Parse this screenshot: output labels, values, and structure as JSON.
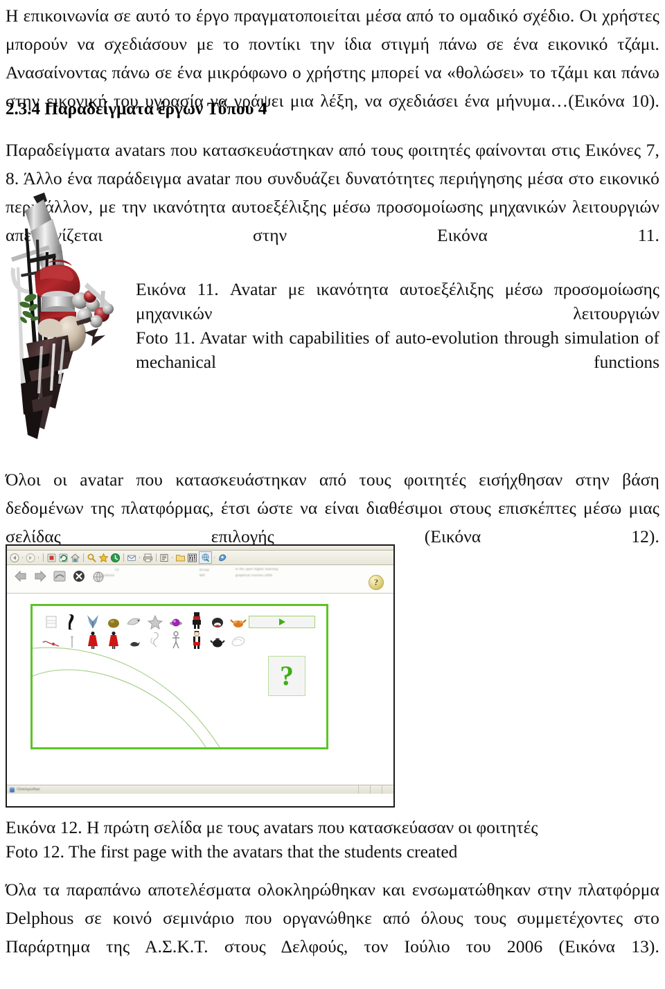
{
  "document": {
    "paragraph_1": "Η επικοινωνία σε αυτό το έργο πραγματοποιείται μέσα από το ομαδικό σχέδιο. Οι χρήστες μπορούν να σχεδιάσουν με το ποντίκι την ίδια στιγμή πάνω σε ένα εικονικό τζάμι. Ανασαίνοντας πάνω σε ένα μικρόφωνο ο χρήστης μπορεί να «θολώσει» το τζάμι και πάνω στην εικονική του υγρασία να γράψει μια λέξη, να σχεδιάσει ένα μήνυμα…(Εικόνα 10).",
    "heading_234": "2.3.4 Παραδείγματα έργων Τύπου 4",
    "paragraph_2": "Παραδείγματα avatars που κατασκευάστηκαν από τους φοιτητές φαίνονται στις Εικόνες 7, 8. Άλλο ένα παράδειγμα avatar που συνδυάζει δυνατότητες περιήγησης μέσα στο εικονικό περιβάλλον, με την ικανότητα αυτοεξέλιξης μέσω προσομοίωσης μηχανικών λειτουργιών απεικονίζεται στην Εικόνα 11.",
    "caption_11_gr": "Εικόνα 11. Avatar με ικανότητα αυτοεξέλιξης μέσω προσομοίωσης μηχανικών λειτουργιών",
    "caption_11_en": "Foto 11. Avatar with capabilities of auto-evolution through simulation of mechanical functions",
    "paragraph_3": "Όλοι οι avatar που κατασκευάστηκαν από τους φοιτητές εισήχθησαν στην βάση δεδομένων της πλατφόρμας, έτσι ώστε να είναι διαθέσιμοι στους επισκέπτες μέσω μιας σελίδας επιλογής (Εικόνα 12).",
    "caption_12_gr": "Εικόνα 12. Η πρώτη σελίδα με τους avatars που κατασκεύασαν  οι φοιτητές",
    "caption_12_en": "Foto 12. The first page with the avatars that the students created",
    "paragraph_4": "Όλα τα παραπάνω αποτελέσματα ολοκληρώθηκαν και ενσωματώθηκαν στην πλατφόρμα Delphous σε κοινό σεμινάριο που οργανώθηκε από όλους τους συμμετέχοντες στο Παράρτημα της Α.Σ.Κ.Τ. στους Δελφούς, τον Ιούλιο του 2006 (Εικόνα 13)."
  },
  "figure_11": {
    "alt": "3D rendered avatar composed of metallic cylinders, red fabric, spheres and dark blades",
    "palette": {
      "metal": "#c9c9c9",
      "metal_dark": "#8a8a8a",
      "red": "#9e1f22",
      "red_light": "#c4373a",
      "blade": "#4a3535",
      "green": "#3f6b2d",
      "skin": "#d9cdbd"
    }
  },
  "figure_12": {
    "browser": {
      "toolbar_icons": [
        "back-icon",
        "forward-icon",
        "stop-icon",
        "refresh-icon",
        "home-icon",
        "search-icon",
        "favorites-icon",
        "history-icon",
        "mail-icon",
        "print-icon",
        "edit-icon",
        "folder-icon",
        "messenger-icon",
        "translate-icon",
        "realplayer-icon"
      ],
      "statusbar_text": "Ολοκληρώθηκε"
    },
    "page": {
      "nav_icons": [
        "previous-arrow-icon",
        "next-arrow-icon",
        "shuffle-icon",
        "close-icon",
        "home-globe-icon"
      ],
      "help_badge_label": "?",
      "header_line_1": "Group",
      "header_line_2": "Mill",
      "header_line_3": "in the open higher learning",
      "header_line_4": "graphical courses 2005",
      "header_left_1": "13",
      "header_left_2": "students",
      "play_button_label": "▶",
      "question_button_label": "?",
      "avatar_count": 20,
      "avatar_rows": [
        [
          "paper-avatar",
          "dark-figure-avatar",
          "blue-arrow-avatar",
          "olive-sphere-avatar",
          "grey-bird-avatar",
          "grey-star-avatar",
          "purple-orb-avatar",
          "red-black-figure-avatar",
          "dark-mouth-avatar",
          "orange-crab-avatar"
        ],
        [
          "thin-wire-avatar",
          "tiny-stick-avatar",
          "red-dress-avatar",
          "red-dress-avatar-2",
          "small-dark-avatar",
          "white-sketch-avatar",
          "white-figure-avatar",
          "clown-avatar",
          "black-teapot-avatar",
          "white-scribble-avatar"
        ]
      ]
    },
    "colors": {
      "frame_green": "#5cc426",
      "play_green": "#3fae17",
      "arc_green": "#a9d18e",
      "chrome": "#e8e6d8",
      "window_border": "#1b1b1b"
    }
  }
}
